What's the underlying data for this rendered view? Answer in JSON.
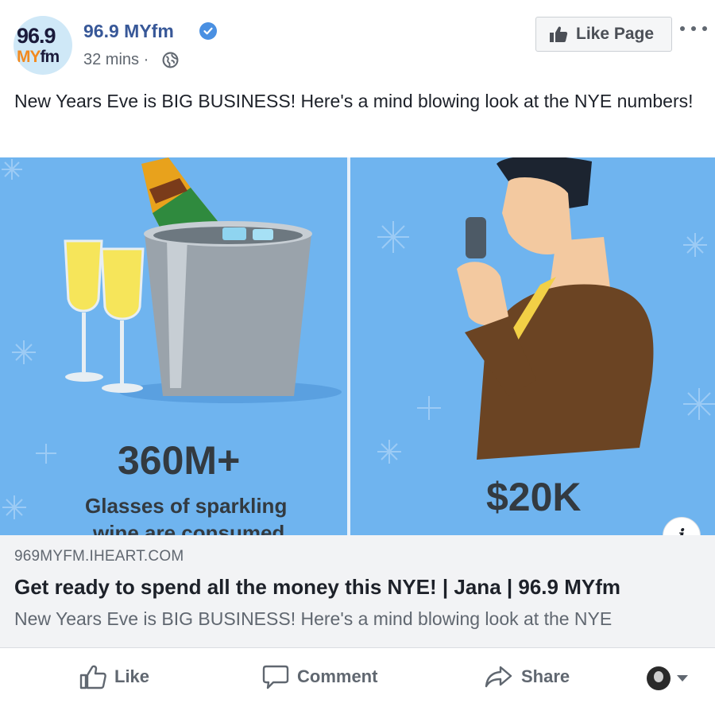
{
  "page": {
    "name": "96.9 MYfm",
    "avatar_line1": "96.9",
    "avatar_line2a": "MY",
    "avatar_line2b": "fm",
    "timestamp": "32 mins ·",
    "like_page_label": "Like Page"
  },
  "post": {
    "text": "New Years Eve is BIG BUSINESS! Here's a mind blowing look at the NYE numbers!"
  },
  "image": {
    "stat1_value": "360M+",
    "stat1_label_line1": "Glasses of sparkling",
    "stat1_label_line2": "wine are consumed",
    "stat2_value": "$20K",
    "info_label": "i",
    "background_color": "#6fb4ef"
  },
  "link": {
    "domain": "969MYFM.IHEART.COM",
    "title": "Get ready to spend all the money this NYE! | Jana | 96.9 MYfm",
    "description": "New Years Eve is BIG BUSINESS! Here's a mind blowing look at the NYE"
  },
  "actions": {
    "like": "Like",
    "comment": "Comment",
    "share": "Share"
  },
  "colors": {
    "link_blue": "#385898",
    "text_gray": "#606770",
    "verified_blue": "#4a90e2"
  }
}
